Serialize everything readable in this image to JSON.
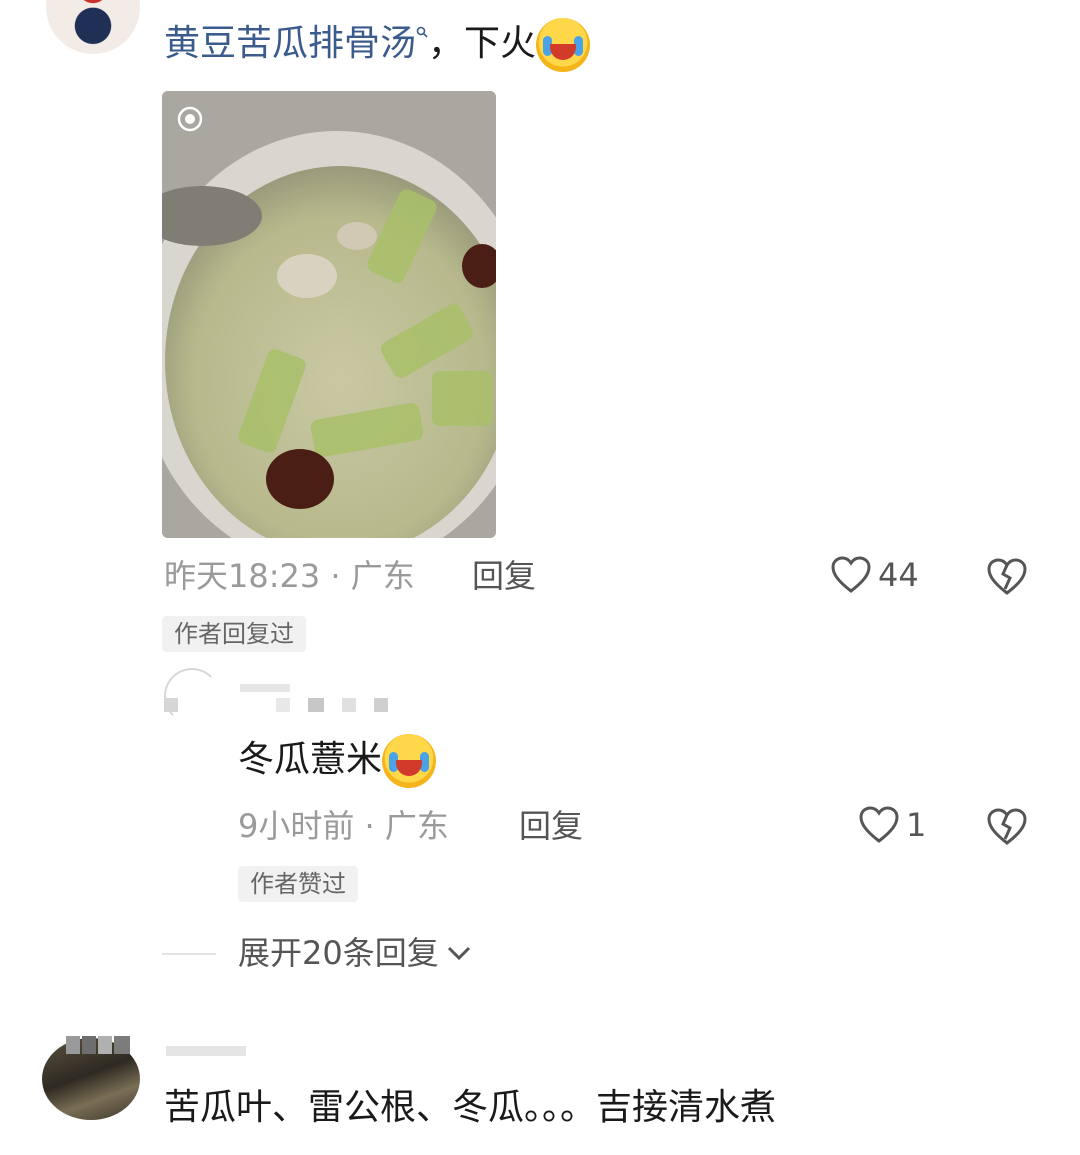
{
  "comment1": {
    "topic": "黄豆苦瓜排骨汤",
    "text_suffix": "，下火",
    "time": "昨天18:23",
    "location": "广东",
    "reply_label": "回复",
    "like_count": "44",
    "badge": "作者回复过"
  },
  "reply1": {
    "text": "冬瓜薏米",
    "time": "9小时前",
    "location": "广东",
    "reply_label": "回复",
    "like_count": "1",
    "badge": "作者赞过"
  },
  "expand": {
    "label": "展开20条回复"
  },
  "comment2": {
    "text": "苦瓜叶、雷公根、冬瓜。。。吉接清水煮"
  },
  "colors": {
    "topic": "#3b5b8c",
    "meta": "#9a9a9a",
    "chip_bg": "#f1f1f1"
  },
  "icons": [
    "search-icon",
    "emoji-crying-icon",
    "heart-icon",
    "broken-heart-icon",
    "chevron-down-icon",
    "live-photo-icon"
  ]
}
